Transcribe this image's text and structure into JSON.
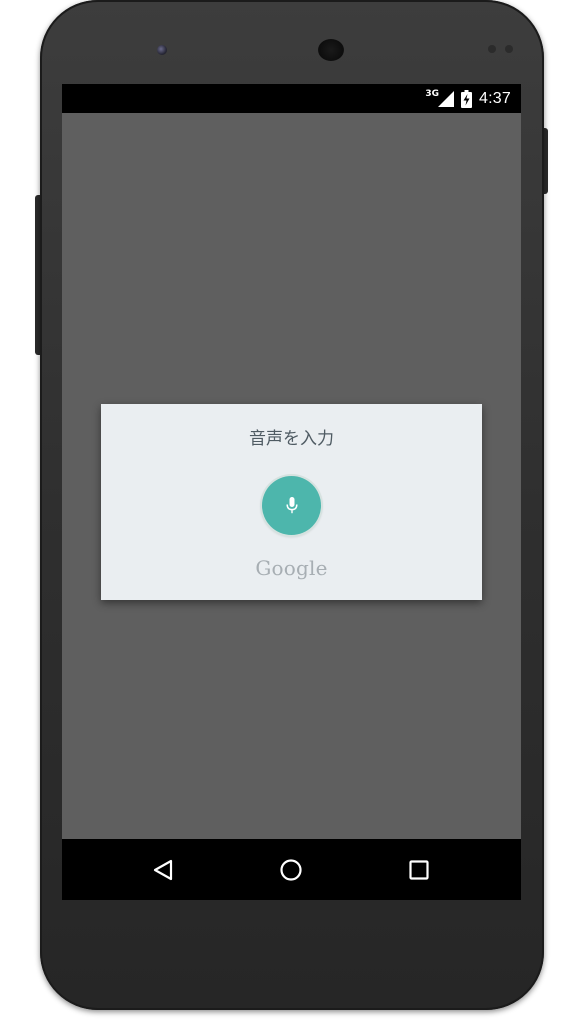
{
  "status_bar": {
    "network_type": "3G",
    "time": "4:37",
    "icons": [
      "signal-icon",
      "battery-charging-icon"
    ]
  },
  "dialog": {
    "title": "音声を入力",
    "mic_icon": "microphone-icon",
    "brand": "Google"
  },
  "nav_bar": {
    "icons": [
      "back-icon",
      "home-icon",
      "recent-apps-icon"
    ]
  },
  "colors": {
    "screen_dim": "#5f5f5f",
    "dialog_bg": "#eaeef1",
    "mic_accent": "#4db6ac",
    "bar_bg": "#000000"
  }
}
